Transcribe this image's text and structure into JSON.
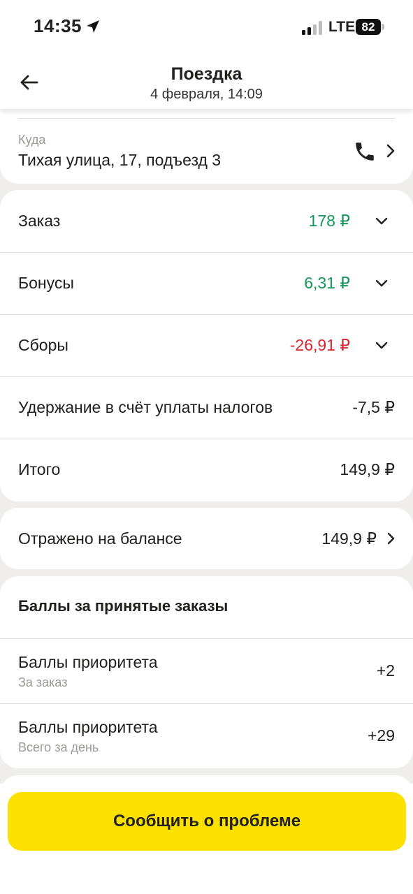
{
  "status_bar": {
    "time": "14:35",
    "network": "LTE",
    "battery": "82",
    "location_icon": "location-arrow-icon",
    "signal_icon": "signal-bars-icon"
  },
  "header": {
    "title": "Поездка",
    "subtitle": "4 февраля, 14:09",
    "back_icon": "arrow-left-icon"
  },
  "destination": {
    "label": "Куда",
    "address": "Тихая улица, 17, подъезд 3",
    "phone_icon": "phone-icon",
    "chevron_icon": "chevron-right-icon"
  },
  "money": {
    "rows": [
      {
        "label": "Заказ",
        "value": "178 ₽",
        "color": "#16965a",
        "expandable": true
      },
      {
        "label": "Бонусы",
        "value": "6,31 ₽",
        "color": "#16965a",
        "expandable": true
      },
      {
        "label": "Сборы",
        "value": "-26,91 ₽",
        "color": "#d6262e",
        "expandable": true
      },
      {
        "label": "Удержание в счёт уплаты налогов",
        "value": "-7,5 ₽",
        "expandable": false
      },
      {
        "label": "Итого",
        "value": "149,9 ₽",
        "expandable": false
      }
    ]
  },
  "balance": {
    "label": "Отражено на балансе",
    "value": "149,9 ₽"
  },
  "points": {
    "title": "Баллы за принятые заказы",
    "items": [
      {
        "label": "Баллы приоритета",
        "sub": "За заказ",
        "value": "+2"
      },
      {
        "label": "Баллы приоритета",
        "sub": "Всего за день",
        "value": "+29"
      }
    ]
  },
  "footer": {
    "report_button": "Сообщить о проблеме",
    "button_color": "#fce000"
  }
}
